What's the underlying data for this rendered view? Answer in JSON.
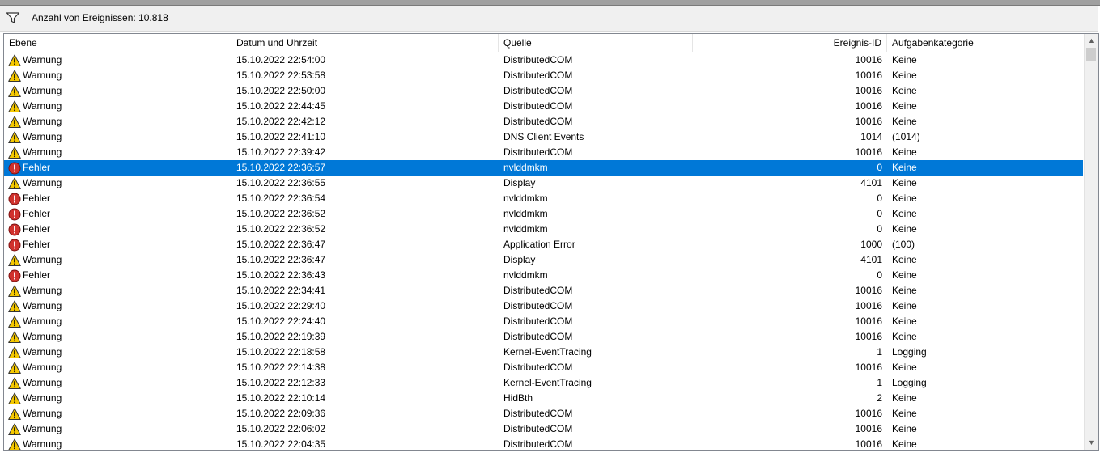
{
  "toolbar": {
    "count_label": "Anzahl von Ereignissen: 10.818"
  },
  "columns": [
    "Ebene",
    "Datum und Uhrzeit",
    "Quelle",
    "Ereignis-ID",
    "Aufgabenkategorie"
  ],
  "rows": [
    {
      "level": "Warnung",
      "date": "15.10.2022 22:54:00",
      "source": "DistributedCOM",
      "id": "10016",
      "category": "Keine"
    },
    {
      "level": "Warnung",
      "date": "15.10.2022 22:53:58",
      "source": "DistributedCOM",
      "id": "10016",
      "category": "Keine"
    },
    {
      "level": "Warnung",
      "date": "15.10.2022 22:50:00",
      "source": "DistributedCOM",
      "id": "10016",
      "category": "Keine"
    },
    {
      "level": "Warnung",
      "date": "15.10.2022 22:44:45",
      "source": "DistributedCOM",
      "id": "10016",
      "category": "Keine"
    },
    {
      "level": "Warnung",
      "date": "15.10.2022 22:42:12",
      "source": "DistributedCOM",
      "id": "10016",
      "category": "Keine"
    },
    {
      "level": "Warnung",
      "date": "15.10.2022 22:41:10",
      "source": "DNS Client Events",
      "id": "1014",
      "category": "(1014)"
    },
    {
      "level": "Warnung",
      "date": "15.10.2022 22:39:42",
      "source": "DistributedCOM",
      "id": "10016",
      "category": "Keine"
    },
    {
      "level": "Fehler",
      "date": "15.10.2022 22:36:57",
      "source": "nvlddmkm",
      "id": "0",
      "category": "Keine",
      "selected": true
    },
    {
      "level": "Warnung",
      "date": "15.10.2022 22:36:55",
      "source": "Display",
      "id": "4101",
      "category": "Keine"
    },
    {
      "level": "Fehler",
      "date": "15.10.2022 22:36:54",
      "source": "nvlddmkm",
      "id": "0",
      "category": "Keine"
    },
    {
      "level": "Fehler",
      "date": "15.10.2022 22:36:52",
      "source": "nvlddmkm",
      "id": "0",
      "category": "Keine"
    },
    {
      "level": "Fehler",
      "date": "15.10.2022 22:36:52",
      "source": "nvlddmkm",
      "id": "0",
      "category": "Keine"
    },
    {
      "level": "Fehler",
      "date": "15.10.2022 22:36:47",
      "source": "Application Error",
      "id": "1000",
      "category": "(100)"
    },
    {
      "level": "Warnung",
      "date": "15.10.2022 22:36:47",
      "source": "Display",
      "id": "4101",
      "category": "Keine"
    },
    {
      "level": "Fehler",
      "date": "15.10.2022 22:36:43",
      "source": "nvlddmkm",
      "id": "0",
      "category": "Keine"
    },
    {
      "level": "Warnung",
      "date": "15.10.2022 22:34:41",
      "source": "DistributedCOM",
      "id": "10016",
      "category": "Keine"
    },
    {
      "level": "Warnung",
      "date": "15.10.2022 22:29:40",
      "source": "DistributedCOM",
      "id": "10016",
      "category": "Keine"
    },
    {
      "level": "Warnung",
      "date": "15.10.2022 22:24:40",
      "source": "DistributedCOM",
      "id": "10016",
      "category": "Keine"
    },
    {
      "level": "Warnung",
      "date": "15.10.2022 22:19:39",
      "source": "DistributedCOM",
      "id": "10016",
      "category": "Keine"
    },
    {
      "level": "Warnung",
      "date": "15.10.2022 22:18:58",
      "source": "Kernel-EventTracing",
      "id": "1",
      "category": "Logging"
    },
    {
      "level": "Warnung",
      "date": "15.10.2022 22:14:38",
      "source": "DistributedCOM",
      "id": "10016",
      "category": "Keine"
    },
    {
      "level": "Warnung",
      "date": "15.10.2022 22:12:33",
      "source": "Kernel-EventTracing",
      "id": "1",
      "category": "Logging"
    },
    {
      "level": "Warnung",
      "date": "15.10.2022 22:10:14",
      "source": "HidBth",
      "id": "2",
      "category": "Keine"
    },
    {
      "level": "Warnung",
      "date": "15.10.2022 22:09:36",
      "source": "DistributedCOM",
      "id": "10016",
      "category": "Keine"
    },
    {
      "level": "Warnung",
      "date": "15.10.2022 22:06:02",
      "source": "DistributedCOM",
      "id": "10016",
      "category": "Keine"
    },
    {
      "level": "Warnung",
      "date": "15.10.2022 22:04:35",
      "source": "DistributedCOM",
      "id": "10016",
      "category": "Keine"
    }
  ],
  "icons": {
    "Warnung": "warning-icon",
    "Fehler": "error-icon",
    "filter": "filter-icon"
  },
  "colors": {
    "selection": "#0078d7",
    "warning": "#f5c800",
    "error": "#d0312d"
  }
}
